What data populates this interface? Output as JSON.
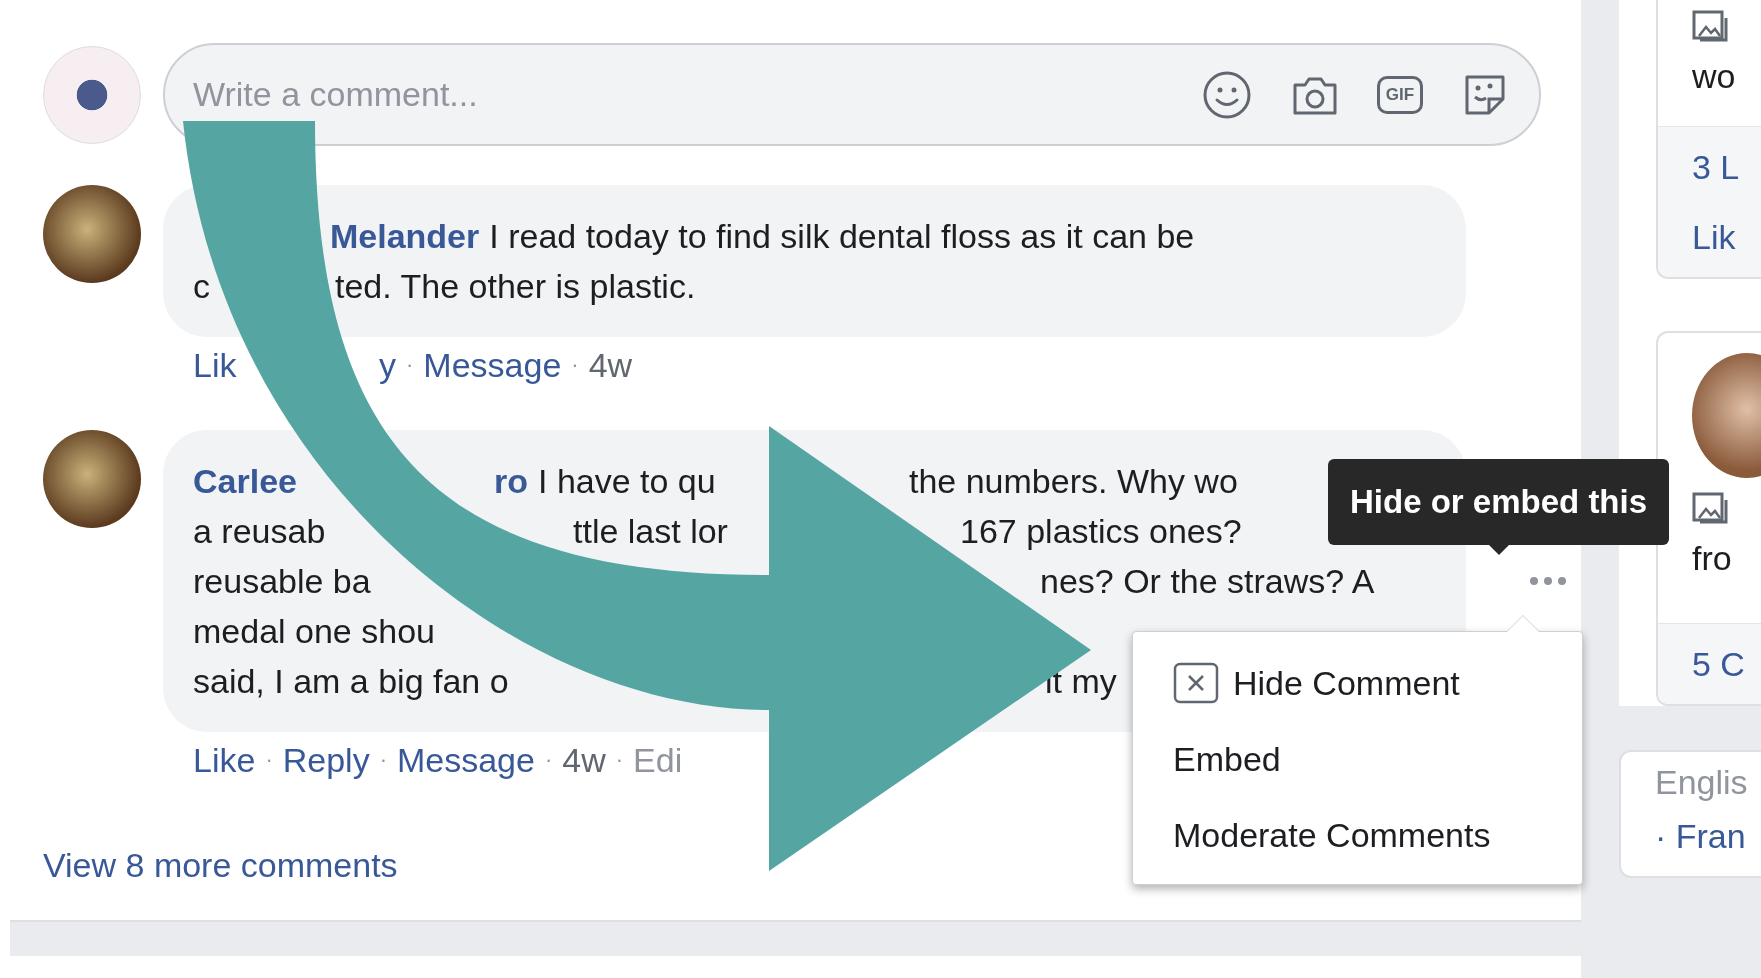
{
  "composer": {
    "placeholder": "Write a comment...",
    "gif_label": "GIF"
  },
  "comments": [
    {
      "lines": [
        [
          [
            {
              "kind": "author",
              "text": "Melander"
            },
            {
              "kind": "body",
              "text": "I read today to find silk dental floss as it can be"
            }
          ]
        ],
        [
          [
            {
              "kind": "body",
              "text": "c"
            }
          ],
          [
            {
              "kind": "body",
              "text": "ted. The other is plastic."
            }
          ]
        ]
      ],
      "actions": [
        [
          {
            "kind": "link",
            "text": "Lik"
          }
        ],
        [
          {
            "kind": "link",
            "text": "y"
          },
          {
            "kind": "sep",
            "text": "·"
          },
          {
            "kind": "link",
            "text": "Message"
          },
          {
            "kind": "sep",
            "text": "·"
          },
          {
            "kind": "meta",
            "text": "4w"
          }
        ]
      ],
      "options_visible": false
    },
    {
      "lines": [
        [
          [
            {
              "kind": "author",
              "text": "Carlee"
            }
          ],
          [
            {
              "kind": "author",
              "text": "ro"
            },
            {
              "kind": "body",
              "text": "I have to qu"
            }
          ],
          [
            {
              "kind": "body",
              "text": "the numbers. Why wo"
            }
          ]
        ],
        [
          [
            {
              "kind": "body",
              "text": "a reusab"
            }
          ],
          [
            {
              "kind": "body",
              "text": "ttle last lor"
            }
          ],
          [
            {
              "kind": "body",
              "text": "167 plastics ones?"
            }
          ]
        ],
        [
          [
            {
              "kind": "body",
              "text": "reusable ba"
            }
          ],
          [
            {
              "kind": "body",
              "text": "nes? Or the straws? A"
            }
          ]
        ],
        [
          [
            {
              "kind": "body",
              "text": "medal one shou"
            }
          ]
        ],
        [
          [
            {
              "kind": "body",
              "text": "said, I am a big fan o"
            }
          ],
          [
            {
              "kind": "body",
              "text": "it my"
            }
          ]
        ]
      ],
      "actions": [
        [
          {
            "kind": "link",
            "text": "Like"
          },
          {
            "kind": "sep",
            "text": "·"
          },
          {
            "kind": "link",
            "text": "Reply"
          },
          {
            "kind": "sep",
            "text": "·"
          },
          {
            "kind": "link",
            "text": "Message"
          },
          {
            "kind": "sep",
            "text": "·"
          },
          {
            "kind": "meta",
            "text": "4w"
          },
          {
            "kind": "sep",
            "text": "·"
          },
          {
            "kind": "muted",
            "text": "Edi"
          }
        ]
      ],
      "options_visible": true
    }
  ],
  "view_more": "View 8 more comments",
  "tooltip": "Hide or embed this",
  "menu": {
    "items": [
      {
        "label": "Hide Comment",
        "kind": "hide"
      },
      {
        "label": "Embed",
        "kind": "plain"
      },
      {
        "label": "Moderate Comments",
        "kind": "plain"
      }
    ]
  },
  "side_cards": [
    {
      "body": [
        {
          "kind": "image-icon"
        },
        {
          "kind": "text",
          "text": "wo"
        }
      ],
      "footer": [
        {
          "kind": "link",
          "text": "3 L"
        },
        {
          "kind": "link",
          "text": "Lik"
        }
      ]
    },
    {
      "body": [
        {
          "kind": "avatar"
        },
        {
          "kind": "image-icon"
        },
        {
          "kind": "text",
          "text": "fro"
        }
      ],
      "footer": [
        {
          "kind": "link",
          "text": "5 C"
        }
      ]
    },
    {
      "body": [
        {
          "kind": "muted",
          "text": "Englis"
        },
        {
          "kind": "link",
          "text": "· Fran"
        }
      ]
    }
  ]
}
